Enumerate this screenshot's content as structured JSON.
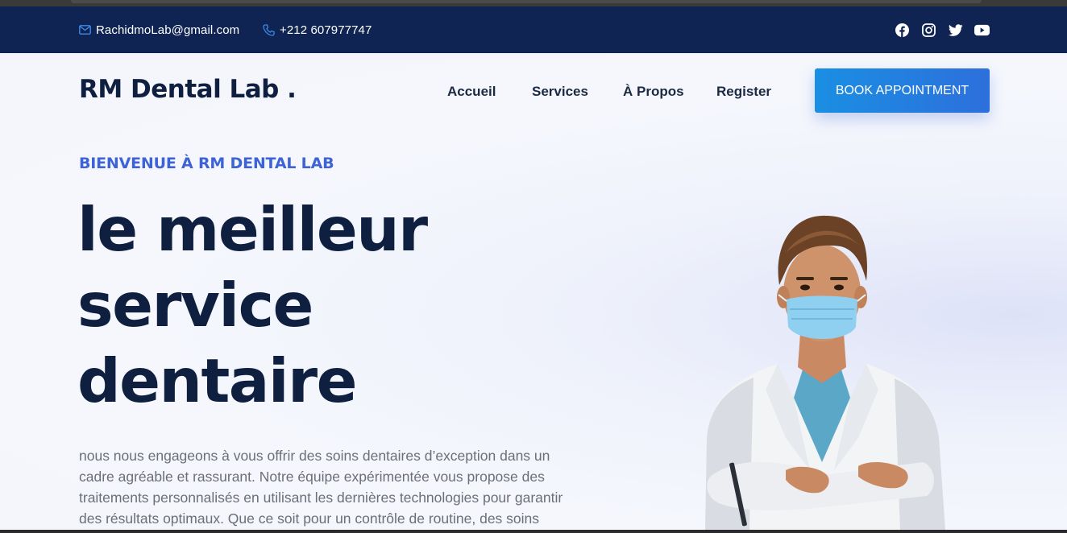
{
  "topbar": {
    "email": "RachidmoLab@gmail.com",
    "phone": "+212 607977747",
    "socials": [
      "facebook-icon",
      "instagram-icon",
      "twitter-icon",
      "youtube-icon"
    ]
  },
  "header": {
    "logo": "RM Dental Lab .",
    "nav": [
      "Accueil",
      "Services",
      "À Propos",
      "Register"
    ],
    "cta": "BOOK APPOINTMENT"
  },
  "hero": {
    "welcome": "BIENVENUE À RM DENTAL LAB",
    "headline": [
      "le meilleur",
      "service",
      "dentaire"
    ],
    "intro": "nous nous engageons à vous offrir des soins dentaires d’exception dans un cadre agréable et rassurant. Notre équipe expérimentée vous propose des traitements personnalisés en utilisant les dernières technologies pour garantir des résultats optimaux. Que ce soit pour un contrôle de routine, des soins"
  },
  "colors": {
    "topbar": "#0f2452",
    "accent": "#3d63d6",
    "button": "#1a8fe3",
    "heading": "#0f1f40"
  }
}
